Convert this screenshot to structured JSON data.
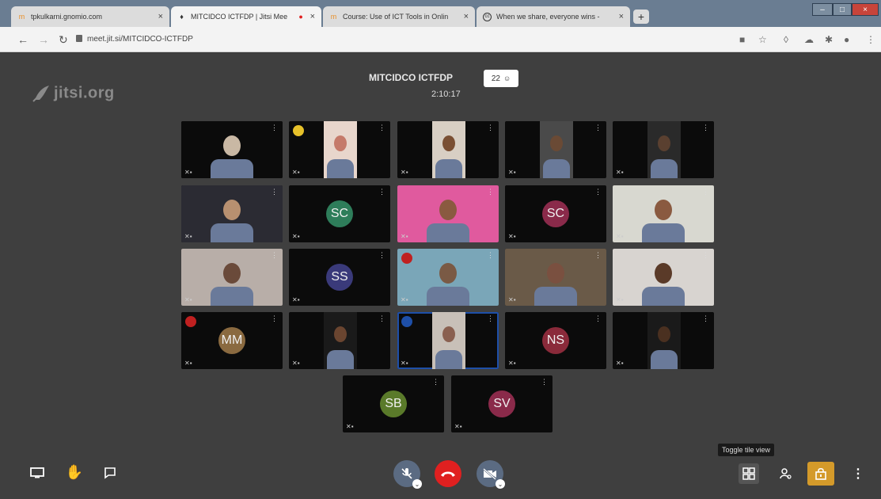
{
  "browser": {
    "tabs": [
      {
        "title": "tpkulkarni.gnomio.com",
        "favicon": "moodle-icon"
      },
      {
        "title": "MITCIDCO ICTFDP | Jitsi Mee",
        "favicon": "jitsi-icon"
      },
      {
        "title": "Course: Use of ICT Tools in Onlin",
        "favicon": "moodle-icon"
      },
      {
        "title": "When we share, everyone wins -",
        "favicon": "cc-icon"
      }
    ],
    "close_glyph": "×",
    "new_tab_glyph": "+",
    "url": "meet.jit.si/MITCIDCO-ICTFDP",
    "window_buttons": [
      "–",
      "□",
      "×"
    ]
  },
  "meeting": {
    "logo": "jitsi.org",
    "title": "MITCIDCO ICTFDP",
    "participant_count": "22",
    "timer": "2:10:17",
    "tooltip": "Toggle tile view"
  },
  "tiles": [
    {
      "type": "video",
      "skin": "#c9b8a4",
      "bg": "#0b0b0b"
    },
    {
      "type": "video",
      "skin": "#c57a6a",
      "bg": "#e8d6cc",
      "badge_color": "#e6c12a"
    },
    {
      "type": "video",
      "skin": "#7a4f33",
      "bg": "#d8cfc4"
    },
    {
      "type": "video",
      "skin": "#6a4a35",
      "bg": "#4a4a4a"
    },
    {
      "type": "video",
      "skin": "#5a4030",
      "bg": "#2a2a2a"
    },
    {
      "type": "video",
      "skin": "#b89070",
      "bg": "#2b2b33"
    },
    {
      "type": "avatar",
      "initials": "SC",
      "color": "#2e7d5a"
    },
    {
      "type": "video",
      "skin": "#8a5a40",
      "bg": "#e05a9e"
    },
    {
      "type": "avatar",
      "initials": "SC",
      "color": "#8a2a4a"
    },
    {
      "type": "video",
      "skin": "#8a5a40",
      "bg": "#d8d8d0"
    },
    {
      "type": "video",
      "skin": "#6a4a3a",
      "bg": "#b8aea8"
    },
    {
      "type": "avatar",
      "initials": "SS",
      "color": "#3a3a7a"
    },
    {
      "type": "video",
      "skin": "#7a5a45",
      "bg": "#7aa6b8",
      "badge_color": "#c02020"
    },
    {
      "type": "video",
      "skin": "#7a5040",
      "bg": "#6a5a48"
    },
    {
      "type": "video",
      "skin": "#5a3a28",
      "bg": "#d8d4d0"
    },
    {
      "type": "avatar",
      "initials": "MM",
      "color": "#8a6a40",
      "badge_color": "#c02020"
    },
    {
      "type": "video",
      "skin": "#6a4530",
      "bg": "#1a1a1a"
    },
    {
      "type": "video",
      "skin": "#8a6050",
      "bg": "#c8c0b8",
      "badge_color": "#1e4fa8"
    },
    {
      "type": "avatar",
      "initials": "NS",
      "color": "#8a2a3a"
    },
    {
      "type": "video",
      "skin": "#4a3020",
      "bg": "#1a1a1a"
    },
    {
      "type": "avatar",
      "initials": "SB",
      "color": "#5a7a2a"
    },
    {
      "type": "avatar",
      "initials": "SV",
      "color": "#8a2a4a"
    }
  ],
  "colors": {
    "stage_bg": "#3f3f3f",
    "tile_bg": "#0b0b0b",
    "hangup": "#e02020",
    "active_tile_border": "#1e4fa8",
    "security_btn": "#d49a2a"
  }
}
